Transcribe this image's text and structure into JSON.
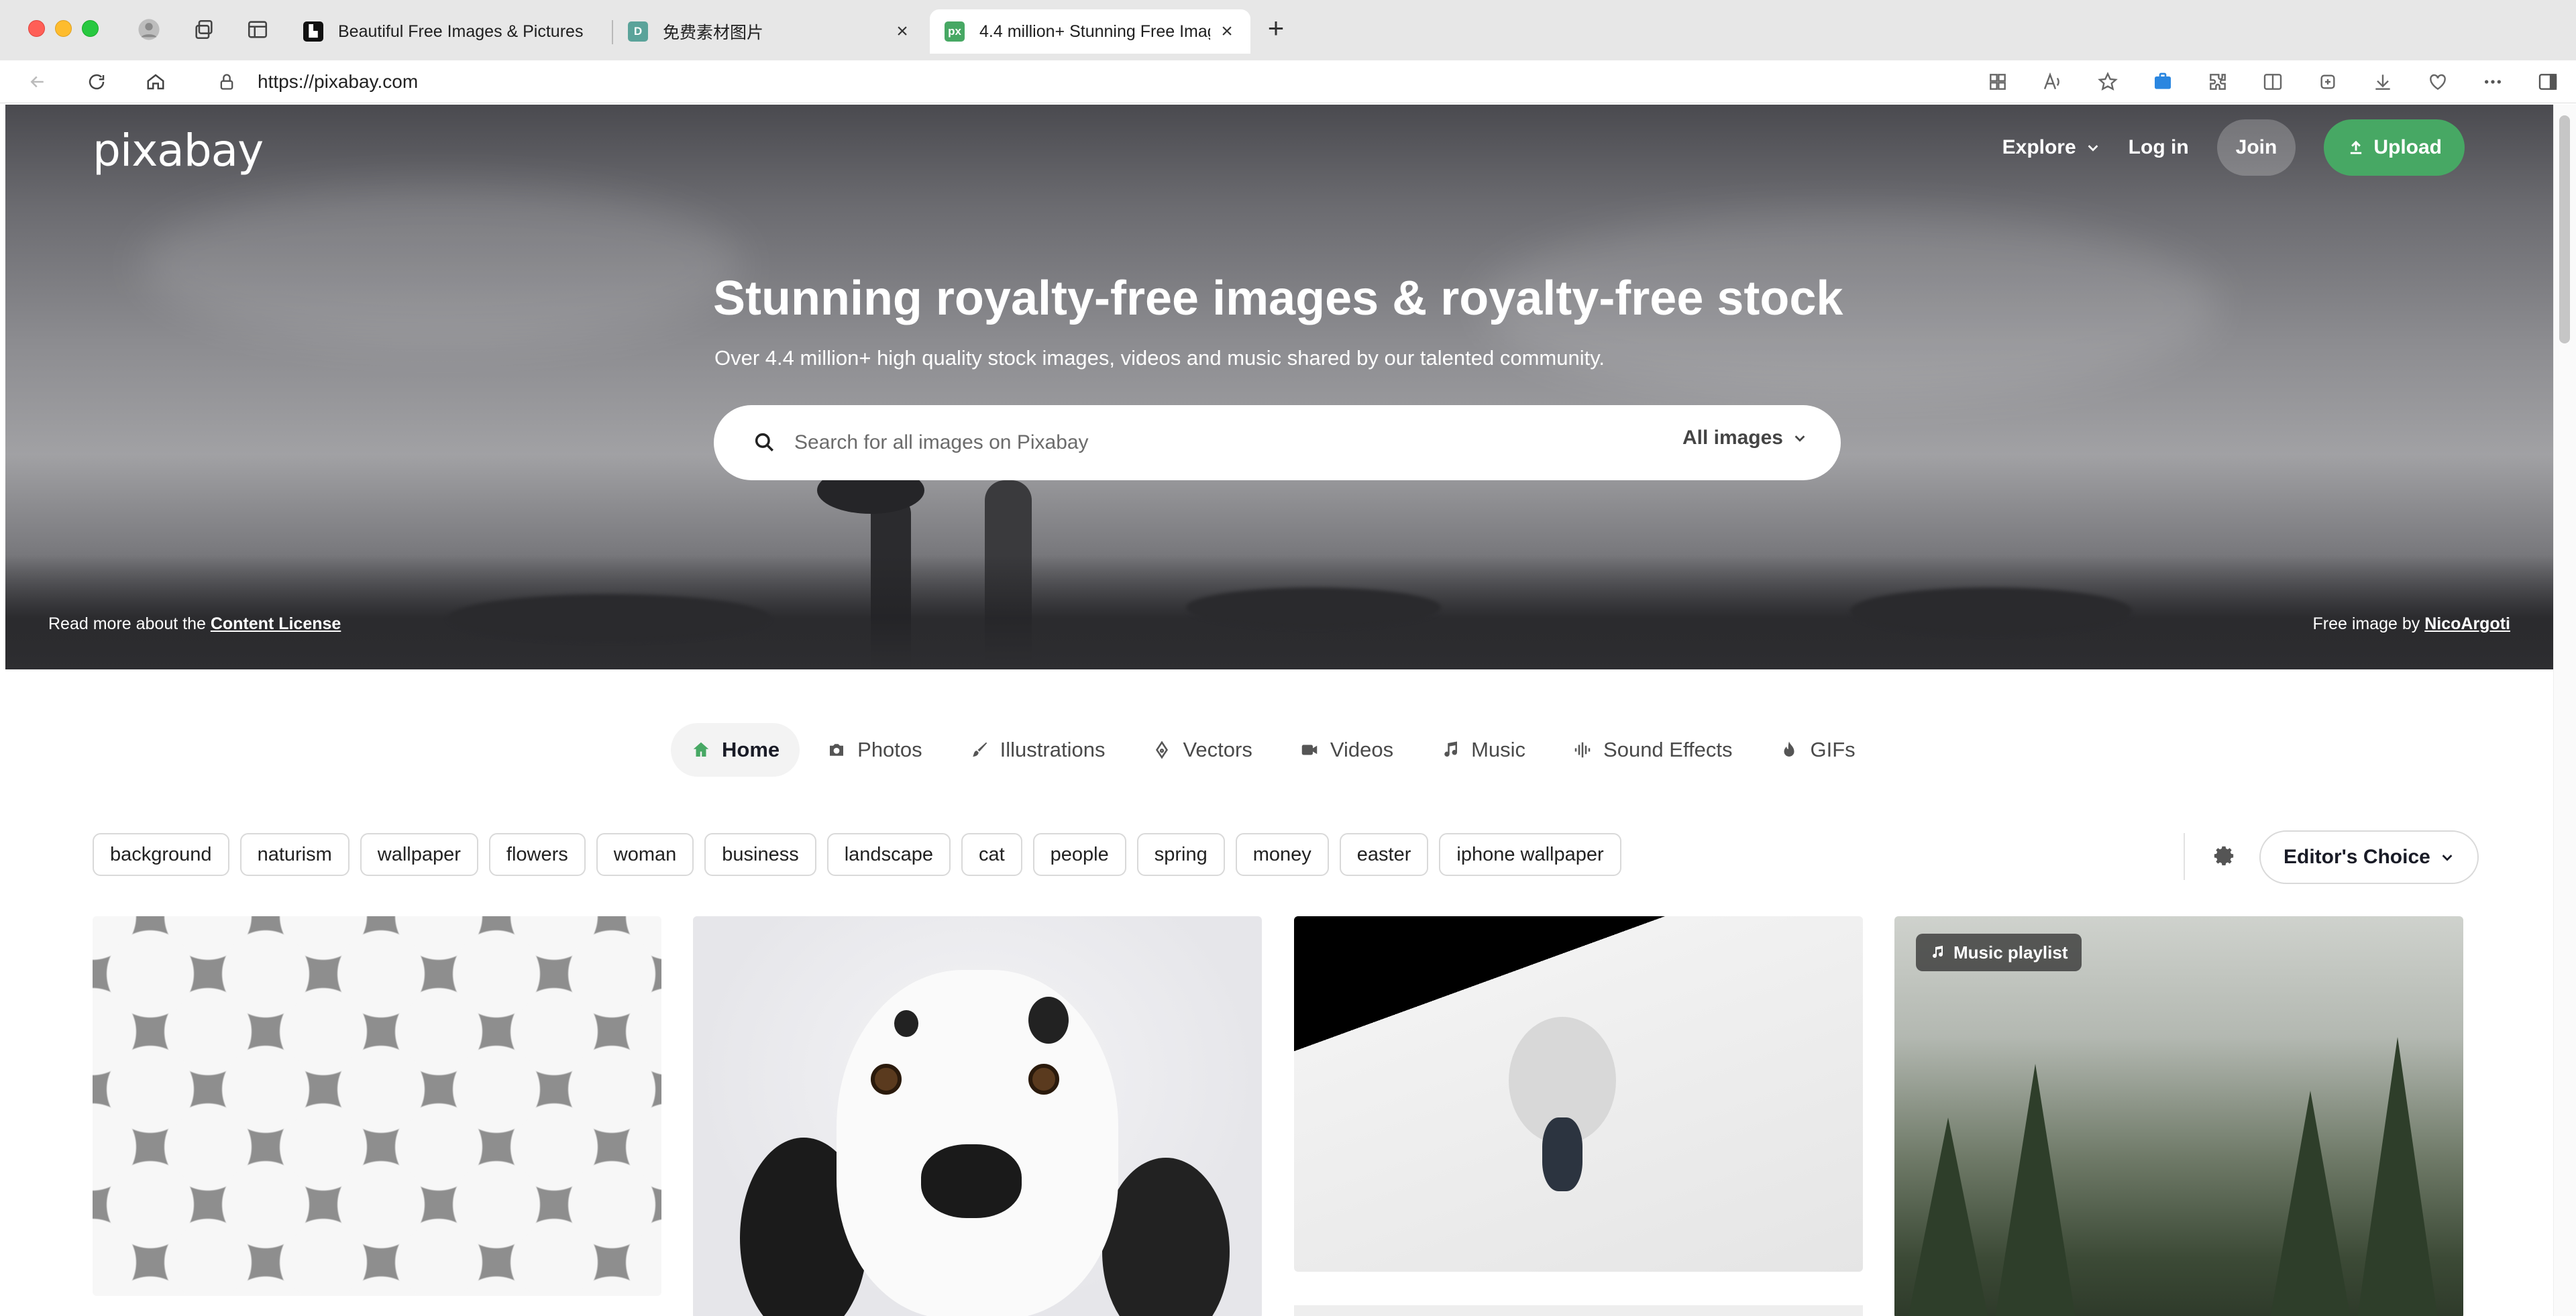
{
  "browser": {
    "tabs": [
      {
        "title": "Beautiful Free Images & Pictures",
        "favicon": "unsplash-favicon"
      },
      {
        "title": "免费素材图片",
        "favicon": "d-favicon"
      },
      {
        "title": "4.4 million+ Stunning Free Images",
        "favicon": "pixabay-favicon",
        "active": true
      }
    ],
    "new_tab_label": "+",
    "url": "https://pixabay.com"
  },
  "header": {
    "logo": "pixabay",
    "explore": "Explore",
    "login": "Log in",
    "join": "Join",
    "upload": "Upload"
  },
  "hero": {
    "headline": "Stunning royalty-free images & royalty-free stock",
    "subline": "Over 4.4 million+ high quality stock images, videos and music shared by our talented community.",
    "search_placeholder": "Search for all images on Pixabay",
    "search_scope": "All images",
    "license_prefix": "Read more about the ",
    "license_link": "Content License",
    "credit_prefix": "Free image by ",
    "credit_author": "NicoArgoti"
  },
  "categories": [
    {
      "label": "Home",
      "icon": "home-icon",
      "active": true
    },
    {
      "label": "Photos",
      "icon": "camera-icon"
    },
    {
      "label": "Illustrations",
      "icon": "brush-icon"
    },
    {
      "label": "Vectors",
      "icon": "pen-nib-icon"
    },
    {
      "label": "Videos",
      "icon": "video-camera-icon"
    },
    {
      "label": "Music",
      "icon": "music-note-icon"
    },
    {
      "label": "Sound Effects",
      "icon": "waveform-icon"
    },
    {
      "label": "GIFs",
      "icon": "flame-icon"
    }
  ],
  "tags": [
    "background",
    "naturism",
    "wallpaper",
    "flowers",
    "woman",
    "business",
    "landscape",
    "cat",
    "people",
    "spring",
    "money",
    "easter",
    "iphone wallpaper"
  ],
  "sort": {
    "label": "Editor's Choice"
  },
  "grid": {
    "music_badge": "Music playlist"
  },
  "colors": {
    "accent_green": "#47a864",
    "text_dark": "#191b26"
  }
}
